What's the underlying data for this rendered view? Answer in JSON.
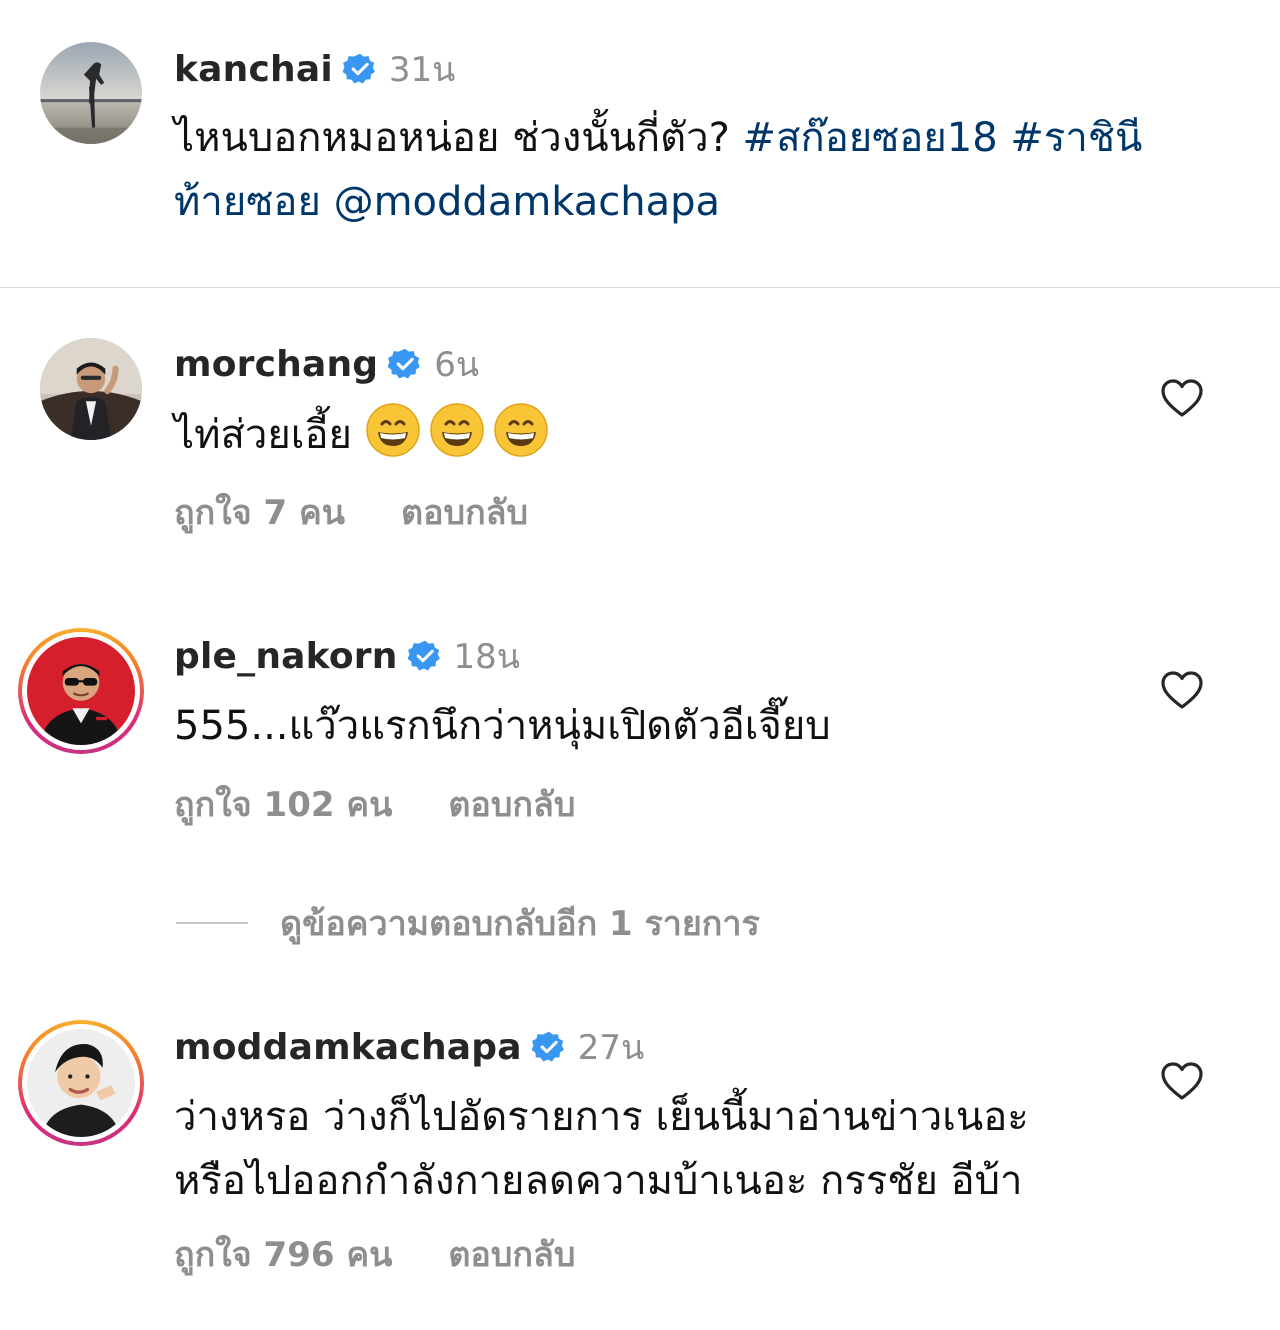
{
  "caption": {
    "username": "kanchai",
    "time": "31น",
    "text_plain": "ไหนบอกหมอหน่อย ช่วงนั้นกี่ตัว? ",
    "hashtag_1": "#สก๊อยซอย18",
    "hashtag_2": "#ราชินีท้ายซอย",
    "mention": "@moddamkachapa",
    "avatar_icon": "caption-avatar-photo"
  },
  "comments": [
    {
      "username": "morchang",
      "time": "6น",
      "text": "ไท่ส่วยเอี้ย",
      "emoji_icon": "grinning-face-with-smiling-eyes",
      "emoji_count": 3,
      "likes": "ถูกใจ 7 คน",
      "reply": "ตอบกลับ",
      "has_story_ring": false
    },
    {
      "username": "ple_nakorn",
      "time": "18น",
      "text": "555...แว๊วแรกนึกว่าหนุ่มเปิดตัวอีเจี๊ยบ",
      "likes": "ถูกใจ 102 คน",
      "reply": "ตอบกลับ",
      "has_story_ring": true
    },
    {
      "username": "moddamkachapa",
      "time": "27น",
      "text_line_1": "ว่างหรอ ว่างก็ไปอัดรายการ เย็นนี้มาอ่านข่าวเนอะ",
      "text_line_2": "หรือไปออกกำลังกายลดความบ้าเนอะ กรรชัย อีบ้า",
      "likes": "ถูกใจ 796 คน",
      "reply": "ตอบกลับ",
      "has_story_ring": true
    }
  ],
  "view_replies": "ดูข้อความตอบกลับอีก 1 รายการ",
  "colors": {
    "link": "#00376b",
    "verified_badge": "#3897f0",
    "secondary_text": "#8e8e8e"
  }
}
